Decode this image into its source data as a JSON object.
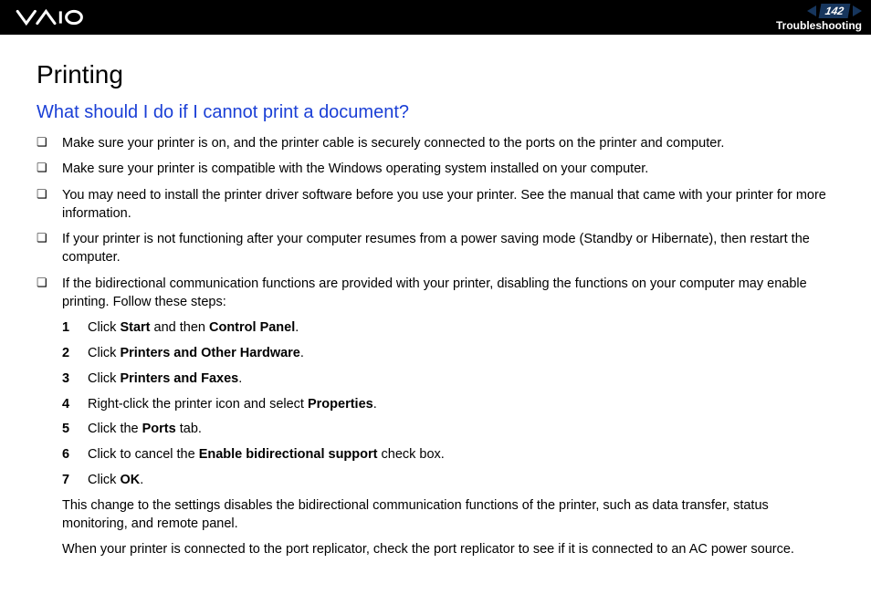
{
  "header": {
    "page_number": "142",
    "section": "Troubleshooting"
  },
  "title": "Printing",
  "question": "What should I do if I cannot print a document?",
  "bullets": [
    "Make sure your printer is on, and the printer cable is securely connected to the ports on the printer and computer.",
    "Make sure your printer is compatible with the Windows operating system installed on your computer.",
    "You may need to install the printer driver software before you use your printer. See the manual that came with your printer for more information.",
    "If your printer is not functioning after your computer resumes from a power saving mode (Standby or Hibernate), then restart the computer.",
    "If the bidirectional communication functions are provided with your printer, disabling the functions on your computer may enable printing. Follow these steps:"
  ],
  "steps": [
    {
      "n": "1",
      "pre": "Click ",
      "b1": "Start",
      "mid": " and then ",
      "b2": "Control Panel",
      "post": "."
    },
    {
      "n": "2",
      "pre": "Click ",
      "b1": "Printers and Other Hardware",
      "mid": "",
      "b2": "",
      "post": "."
    },
    {
      "n": "3",
      "pre": "Click ",
      "b1": "Printers and Faxes",
      "mid": "",
      "b2": "",
      "post": "."
    },
    {
      "n": "4",
      "pre": "Right-click the printer icon and select ",
      "b1": "Properties",
      "mid": "",
      "b2": "",
      "post": "."
    },
    {
      "n": "5",
      "pre": "Click the ",
      "b1": "Ports",
      "mid": " tab.",
      "b2": "",
      "post": ""
    },
    {
      "n": "6",
      "pre": "Click to cancel the ",
      "b1": "Enable bidirectional support",
      "mid": " check box.",
      "b2": "",
      "post": ""
    },
    {
      "n": "7",
      "pre": "Click ",
      "b1": "OK",
      "mid": "",
      "b2": "",
      "post": "."
    }
  ],
  "after_steps": [
    "This change to the settings disables the bidirectional communication functions of the printer, such as data transfer, status monitoring, and remote panel.",
    "When your printer is connected to the port replicator, check the port replicator to see if it is connected to an AC power source."
  ]
}
